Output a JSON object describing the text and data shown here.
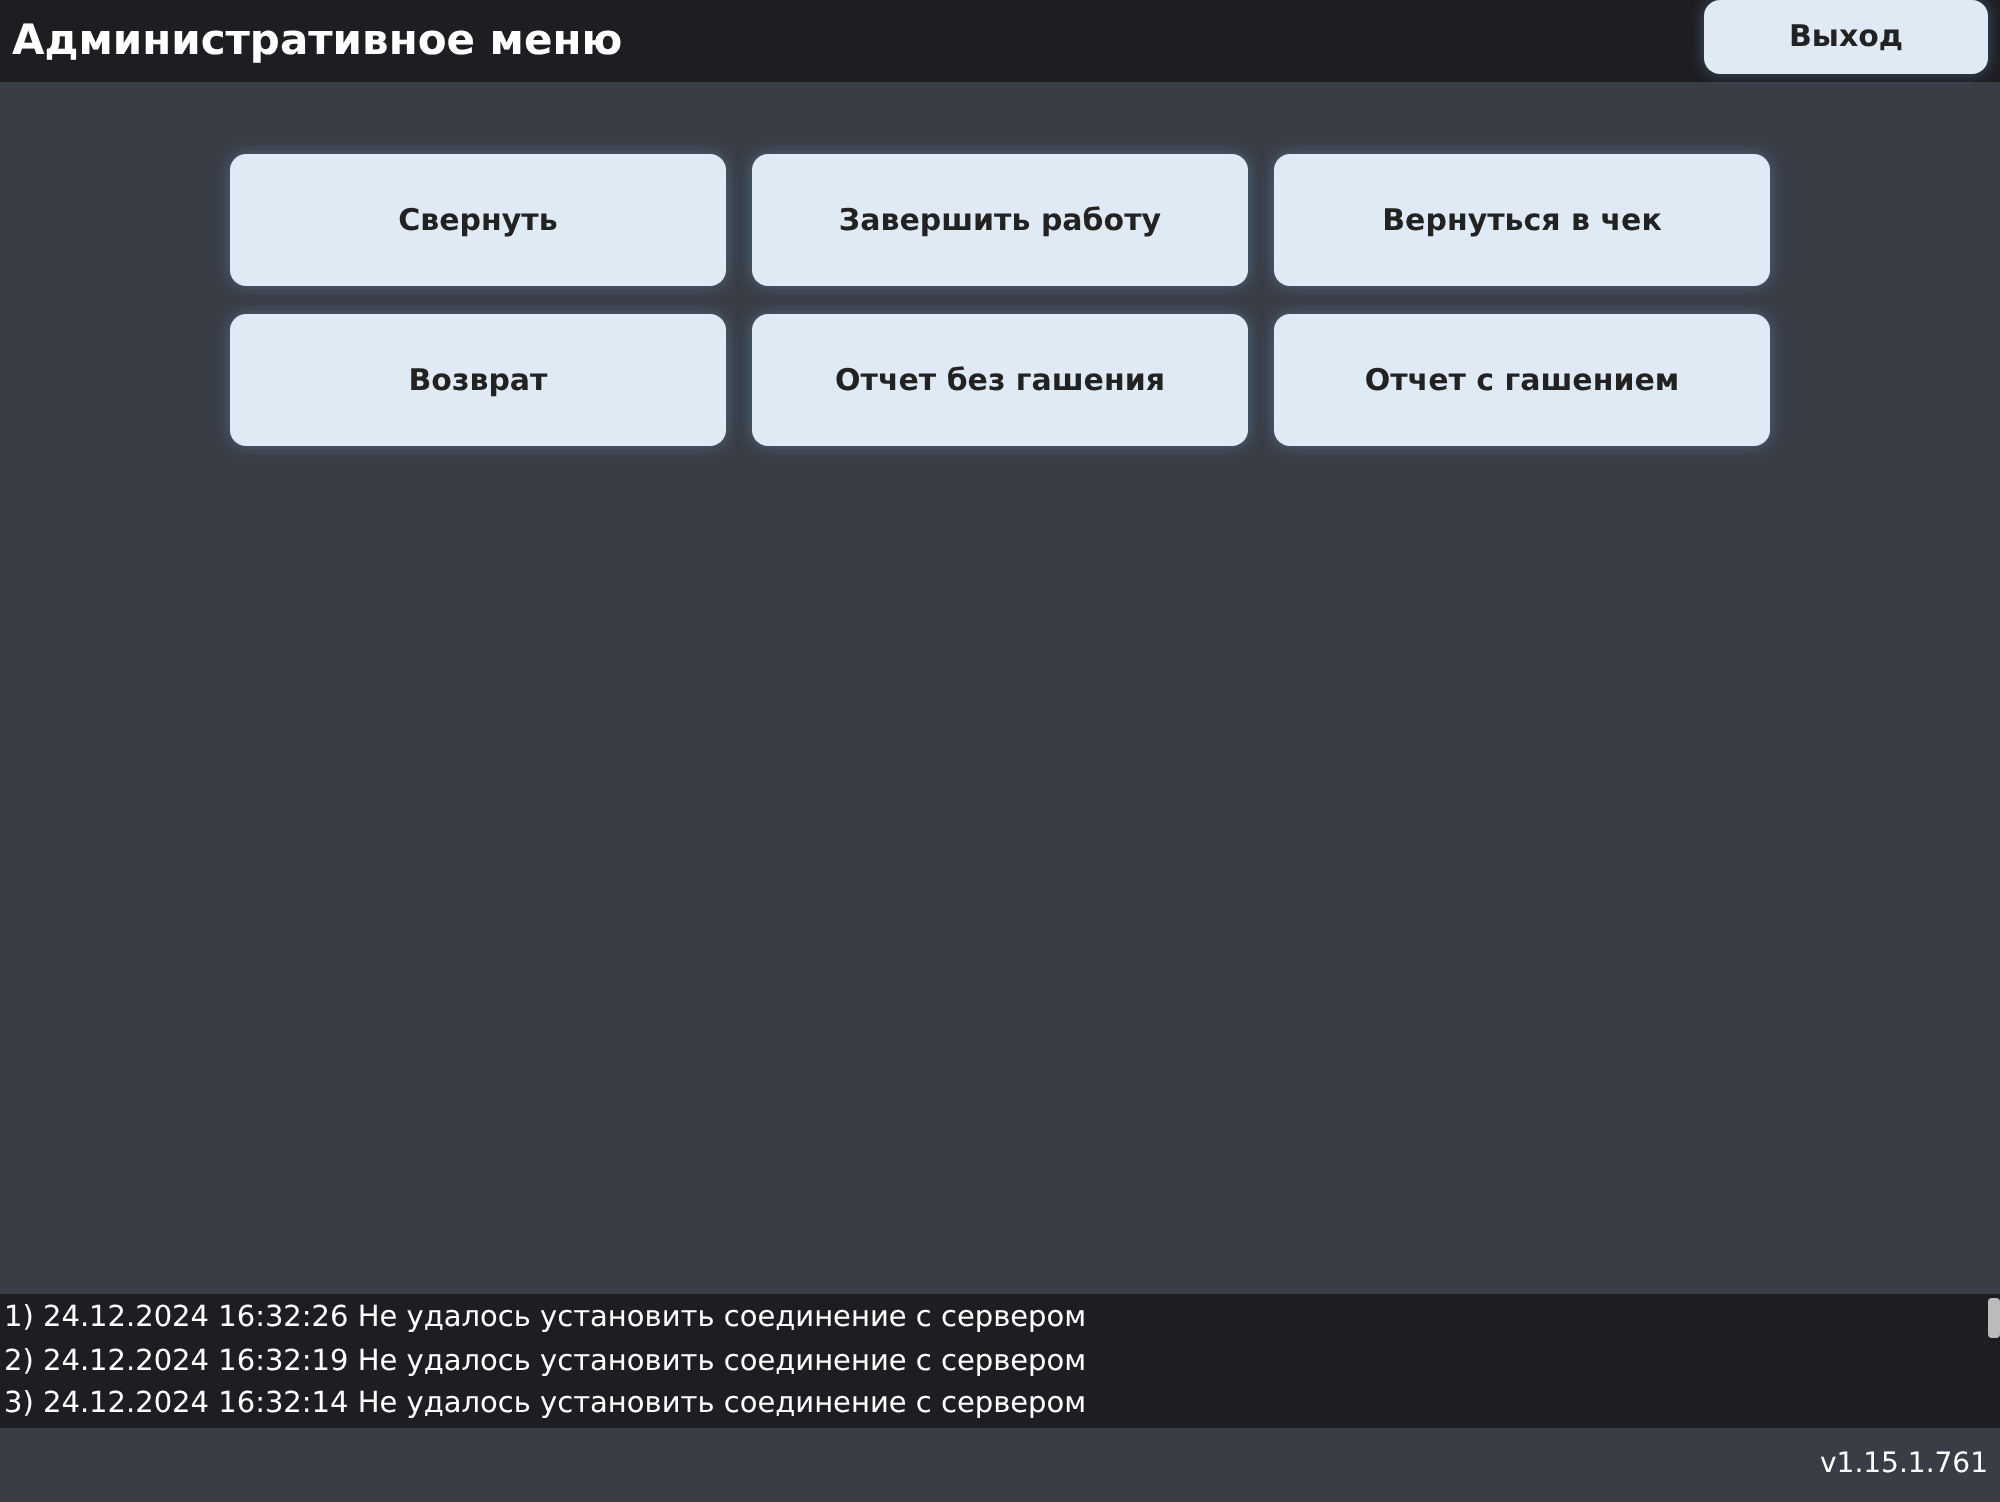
{
  "header": {
    "title": "Административное меню",
    "exit_button": "Выход"
  },
  "menu_buttons": [
    "Свернуть",
    "Завершить работу",
    "Вернуться в чек",
    "Возврат",
    "Отчет без гашения",
    "Отчет с гашением"
  ],
  "log": [
    "1) 24.12.2024 16:32:26 Не удалось установить соединение с сервером",
    "2) 24.12.2024 16:32:19 Не удалось установить соединение с сервером",
    "3) 24.12.2024 16:32:14 Не удалось установить соединение с сервером"
  ],
  "version": "v1.15.1.761"
}
